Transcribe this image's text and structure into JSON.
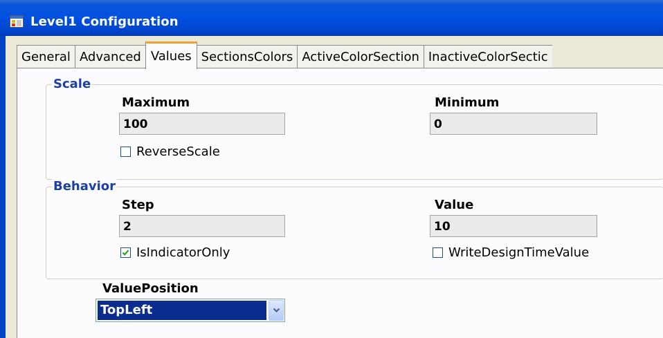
{
  "window": {
    "title": "Level1 Configuration",
    "icon": "app-window-icon"
  },
  "tabs": [
    {
      "label": "General"
    },
    {
      "label": "Advanced"
    },
    {
      "label": "Values",
      "active": true
    },
    {
      "label": "SectionsColors"
    },
    {
      "label": "ActiveColorSection"
    },
    {
      "label": "InactiveColorSectic"
    }
  ],
  "scale": {
    "group_label": "Scale",
    "maximum_label": "Maximum",
    "maximum_value": "100",
    "minimum_label": "Minimum",
    "minimum_value": "0",
    "reverse_scale_label": "ReverseScale",
    "reverse_scale_checked": false
  },
  "behavior": {
    "group_label": "Behavior",
    "step_label": "Step",
    "step_value": "2",
    "value_label": "Value",
    "value_value": "10",
    "is_indicator_only_label": "IsIndicatorOnly",
    "is_indicator_only_checked": true,
    "write_design_time_value_label": "WriteDesignTimeValue",
    "write_design_time_value_checked": false
  },
  "value_position": {
    "label": "ValuePosition",
    "selected": "TopLeft"
  },
  "colors": {
    "titlebar": "#0050e0",
    "group_title": "#1c3fa8",
    "active_tab_accent": "#f0a330",
    "selection": "#0b2d8f",
    "checkmark": "#21a121"
  }
}
